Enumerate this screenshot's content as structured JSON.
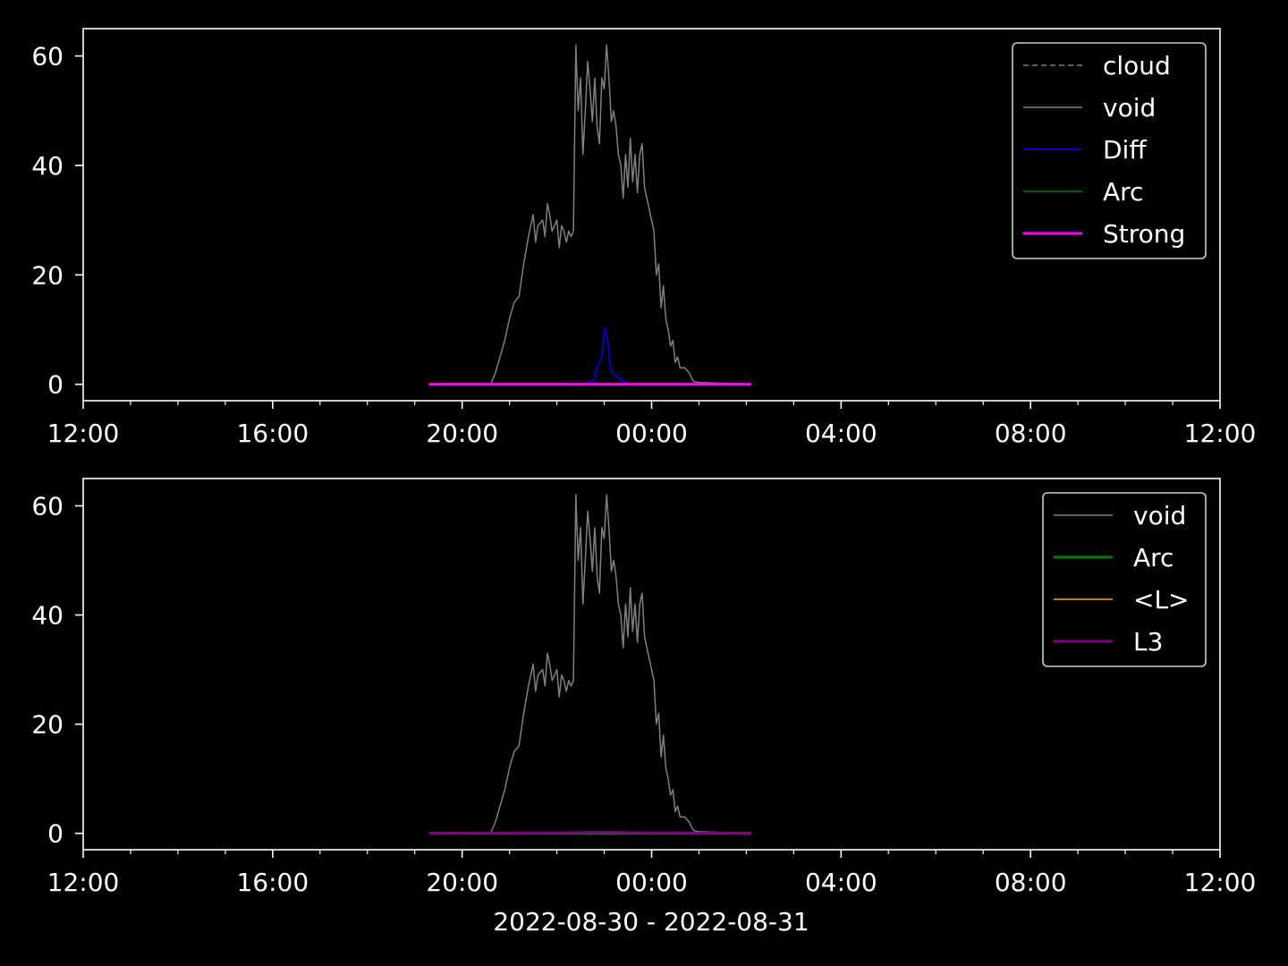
{
  "figure": {
    "background": "#000000",
    "foreground": "#ffffff",
    "xlabel": "2022-08-30 - 2022-08-31"
  },
  "chart_data": [
    {
      "type": "line",
      "x_unit": "hours since 2022-08-30 00:00",
      "xlim": [
        12,
        36
      ],
      "ylim": [
        -3,
        65
      ],
      "x_ticks": [
        12,
        16,
        20,
        24,
        28,
        32,
        36
      ],
      "x_tick_labels": [
        "12:00",
        "16:00",
        "20:00",
        "00:00",
        "04:00",
        "08:00",
        "12:00"
      ],
      "x_minor_ticks": [
        13,
        14,
        15,
        17,
        18,
        19,
        21,
        22,
        23,
        25,
        26,
        27,
        29,
        30,
        31,
        33,
        34,
        35
      ],
      "y_ticks": [
        0,
        20,
        40,
        60
      ],
      "y_tick_labels": [
        "0",
        "20",
        "40",
        "60"
      ],
      "legend_position": "top-right",
      "series": [
        {
          "name": "cloud",
          "color": "#808080",
          "style": "dashed",
          "width": 1.5,
          "points": []
        },
        {
          "name": "void",
          "color": "#808080",
          "style": "solid",
          "width": 1.5,
          "points": [
            [
              19.3,
              0
            ],
            [
              20.6,
              0
            ],
            [
              20.7,
              2
            ],
            [
              20.8,
              5
            ],
            [
              20.9,
              8
            ],
            [
              21.0,
              12
            ],
            [
              21.1,
              15
            ],
            [
              21.2,
              16
            ],
            [
              21.3,
              22
            ],
            [
              21.4,
              27
            ],
            [
              21.5,
              31
            ],
            [
              21.55,
              26
            ],
            [
              21.6,
              29
            ],
            [
              21.7,
              30
            ],
            [
              21.75,
              27
            ],
            [
              21.8,
              33
            ],
            [
              21.85,
              31
            ],
            [
              21.9,
              28
            ],
            [
              22.0,
              30
            ],
            [
              22.05,
              25
            ],
            [
              22.1,
              29
            ],
            [
              22.15,
              28
            ],
            [
              22.2,
              26
            ],
            [
              22.25,
              28
            ],
            [
              22.3,
              27
            ],
            [
              22.35,
              28
            ],
            [
              22.4,
              62
            ],
            [
              22.45,
              50
            ],
            [
              22.5,
              56
            ],
            [
              22.55,
              42
            ],
            [
              22.6,
              50
            ],
            [
              22.65,
              59
            ],
            [
              22.7,
              54
            ],
            [
              22.75,
              48
            ],
            [
              22.8,
              56
            ],
            [
              22.85,
              47
            ],
            [
              22.9,
              44
            ],
            [
              22.95,
              56
            ],
            [
              23.0,
              54
            ],
            [
              23.05,
              62
            ],
            [
              23.1,
              56
            ],
            [
              23.15,
              48
            ],
            [
              23.2,
              50
            ],
            [
              23.25,
              47
            ],
            [
              23.3,
              42
            ],
            [
              23.35,
              40
            ],
            [
              23.4,
              34
            ],
            [
              23.45,
              42
            ],
            [
              23.5,
              36
            ],
            [
              23.55,
              45
            ],
            [
              23.6,
              37
            ],
            [
              23.65,
              42
            ],
            [
              23.7,
              35
            ],
            [
              23.75,
              42
            ],
            [
              23.8,
              44
            ],
            [
              23.85,
              36
            ],
            [
              23.9,
              34
            ],
            [
              24.0,
              30
            ],
            [
              24.05,
              28
            ],
            [
              24.1,
              20
            ],
            [
              24.15,
              22
            ],
            [
              24.2,
              14
            ],
            [
              24.25,
              18
            ],
            [
              24.3,
              12
            ],
            [
              24.35,
              10
            ],
            [
              24.4,
              7
            ],
            [
              24.45,
              8
            ],
            [
              24.5,
              4
            ],
            [
              24.55,
              5
            ],
            [
              24.6,
              3
            ],
            [
              24.7,
              3
            ],
            [
              24.8,
              2
            ],
            [
              24.85,
              1
            ],
            [
              24.9,
              0.5
            ],
            [
              25.0,
              0.3
            ],
            [
              26.1,
              0
            ]
          ]
        },
        {
          "name": "Diff",
          "color": "#0000ff",
          "style": "solid",
          "width": 1.5,
          "points": [
            [
              19.3,
              0
            ],
            [
              22.5,
              0
            ],
            [
              22.7,
              0.3
            ],
            [
              22.8,
              1
            ],
            [
              22.85,
              3
            ],
            [
              22.95,
              5
            ],
            [
              23.02,
              10.3
            ],
            [
              23.08,
              8
            ],
            [
              23.12,
              4
            ],
            [
              23.18,
              2
            ],
            [
              23.25,
              1.5
            ],
            [
              23.35,
              1
            ],
            [
              23.45,
              0.3
            ],
            [
              23.6,
              0
            ],
            [
              26.1,
              0
            ]
          ]
        },
        {
          "name": "Arc",
          "color": "#008000",
          "style": "solid",
          "width": 1.5,
          "points": [
            [
              19.3,
              0
            ],
            [
              26.1,
              0
            ]
          ]
        },
        {
          "name": "Strong",
          "color": "#ff00ff",
          "style": "solid",
          "width": 3,
          "points": [
            [
              19.3,
              0
            ],
            [
              26.1,
              0
            ]
          ]
        }
      ]
    },
    {
      "type": "line",
      "x_unit": "hours since 2022-08-30 00:00",
      "xlim": [
        12,
        36
      ],
      "ylim": [
        -3,
        65
      ],
      "x_ticks": [
        12,
        16,
        20,
        24,
        28,
        32,
        36
      ],
      "x_tick_labels": [
        "12:00",
        "16:00",
        "20:00",
        "00:00",
        "04:00",
        "08:00",
        "12:00"
      ],
      "x_minor_ticks": [
        13,
        14,
        15,
        17,
        18,
        19,
        21,
        22,
        23,
        25,
        26,
        27,
        29,
        30,
        31,
        33,
        34,
        35
      ],
      "y_ticks": [
        0,
        20,
        40,
        60
      ],
      "y_tick_labels": [
        "0",
        "20",
        "40",
        "60"
      ],
      "legend_position": "top-right",
      "series": [
        {
          "name": "void",
          "color": "#808080",
          "style": "solid",
          "width": 1.5,
          "points": [
            [
              19.3,
              0
            ],
            [
              20.6,
              0
            ],
            [
              20.7,
              2
            ],
            [
              20.8,
              5
            ],
            [
              20.9,
              8
            ],
            [
              21.0,
              12
            ],
            [
              21.1,
              15
            ],
            [
              21.2,
              16
            ],
            [
              21.3,
              22
            ],
            [
              21.4,
              27
            ],
            [
              21.5,
              31
            ],
            [
              21.55,
              26
            ],
            [
              21.6,
              29
            ],
            [
              21.7,
              30
            ],
            [
              21.75,
              27
            ],
            [
              21.8,
              33
            ],
            [
              21.85,
              31
            ],
            [
              21.9,
              28
            ],
            [
              22.0,
              30
            ],
            [
              22.05,
              25
            ],
            [
              22.1,
              29
            ],
            [
              22.15,
              28
            ],
            [
              22.2,
              26
            ],
            [
              22.25,
              28
            ],
            [
              22.3,
              27
            ],
            [
              22.35,
              28
            ],
            [
              22.4,
              62
            ],
            [
              22.45,
              50
            ],
            [
              22.5,
              56
            ],
            [
              22.55,
              42
            ],
            [
              22.6,
              50
            ],
            [
              22.65,
              59
            ],
            [
              22.7,
              54
            ],
            [
              22.75,
              48
            ],
            [
              22.8,
              56
            ],
            [
              22.85,
              47
            ],
            [
              22.9,
              44
            ],
            [
              22.95,
              56
            ],
            [
              23.0,
              54
            ],
            [
              23.05,
              62
            ],
            [
              23.1,
              56
            ],
            [
              23.15,
              48
            ],
            [
              23.2,
              50
            ],
            [
              23.25,
              47
            ],
            [
              23.3,
              42
            ],
            [
              23.35,
              40
            ],
            [
              23.4,
              34
            ],
            [
              23.45,
              42
            ],
            [
              23.5,
              36
            ],
            [
              23.55,
              45
            ],
            [
              23.6,
              37
            ],
            [
              23.65,
              42
            ],
            [
              23.7,
              35
            ],
            [
              23.75,
              42
            ],
            [
              23.8,
              44
            ],
            [
              23.85,
              36
            ],
            [
              23.9,
              34
            ],
            [
              24.0,
              30
            ],
            [
              24.05,
              28
            ],
            [
              24.1,
              20
            ],
            [
              24.15,
              22
            ],
            [
              24.2,
              14
            ],
            [
              24.25,
              18
            ],
            [
              24.3,
              12
            ],
            [
              24.35,
              10
            ],
            [
              24.4,
              7
            ],
            [
              24.45,
              8
            ],
            [
              24.5,
              4
            ],
            [
              24.55,
              5
            ],
            [
              24.6,
              3
            ],
            [
              24.7,
              3
            ],
            [
              24.8,
              2
            ],
            [
              24.85,
              1
            ],
            [
              24.9,
              0.5
            ],
            [
              25.0,
              0.3
            ],
            [
              26.1,
              0
            ]
          ]
        },
        {
          "name": "Arc",
          "color": "#008000",
          "style": "solid",
          "width": 3,
          "points": [
            [
              19.3,
              0
            ],
            [
              26.1,
              0
            ]
          ]
        },
        {
          "name": "<L>",
          "color": "#ffa500",
          "style": "solid",
          "width": 1.5,
          "points": [
            [
              19.3,
              0.1
            ],
            [
              26.1,
              0.1
            ]
          ]
        },
        {
          "name": "L3",
          "color": "#800080",
          "style": "solid",
          "width": 3,
          "points": [
            [
              19.3,
              0
            ],
            [
              22,
              0.1
            ],
            [
              23,
              0.2
            ],
            [
              24,
              0.1
            ],
            [
              26.1,
              0
            ]
          ]
        }
      ]
    }
  ]
}
